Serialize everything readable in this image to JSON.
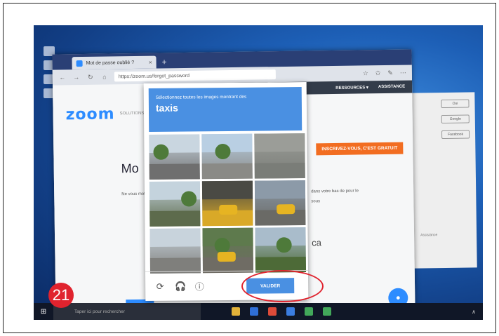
{
  "browser": {
    "tab_title": "Mot de passe oublié ?",
    "tab_close": "×",
    "new_tab": "+",
    "url": "https://zoom.us/forgot_password",
    "nav": [
      "←",
      "→",
      "↻",
      "⌂"
    ],
    "toolbar_icons": [
      "☆",
      "✩",
      "✎",
      "⋯"
    ]
  },
  "site": {
    "nav_items": [
      "RESSOURCES ▾",
      "ASSISTANCE"
    ],
    "logo": "zoom",
    "logo_sub": "SOLUTIONS",
    "signup_label": "INSCRIVEZ-VOUS, C'EST GRATUIT",
    "heading": "Mo",
    "text_left": "Ne vous mot de vous êt",
    "text_right": "dans votre bas de pour le sous",
    "captcha_fragment": "ca",
    "chat_icon": "●"
  },
  "right_window": {
    "buttons": [
      "Oui",
      "Google",
      "Facebook"
    ],
    "footer_text": "Assistance"
  },
  "captcha": {
    "instruction": "Sélectionnez toutes les images montrant des",
    "target": "taxis",
    "footer_icons": [
      "⟳",
      "🎧",
      "ⓘ"
    ],
    "validate_label": "VALIDER",
    "tiles": [
      {
        "sky": "#c9d6e0",
        "ground": "#6f6f6f",
        "tree": true,
        "car": false
      },
      {
        "sky": "#b9cfe3",
        "ground": "#8a8a86",
        "tree": true,
        "car": false
      },
      {
        "sky": "#9b9d98",
        "ground": "#7a7d78",
        "tree": false,
        "car": false
      },
      {
        "sky": "#c4d3dd",
        "ground": "#5d6b4c",
        "tree": true,
        "car": false
      },
      {
        "sky": "#4a4a44",
        "ground": "#d9a928",
        "tree": false,
        "car": true
      },
      {
        "sky": "#8c9aa8",
        "ground": "#6a6a66",
        "tree": false,
        "car": true
      },
      {
        "sky": "#c8d3dc",
        "ground": "#7f7f7c",
        "tree": false,
        "car": false
      },
      {
        "sky": "#5e7a4d",
        "ground": "#6f6c64",
        "tree": true,
        "car": true
      },
      {
        "sky": "#a9bccb",
        "ground": "#4d6a37",
        "tree": true,
        "car": false
      }
    ]
  },
  "taskbar": {
    "start_icon": "⊞",
    "search_placeholder": "Taper ici pour rechercher",
    "app_colors": [
      "#e2b23a",
      "#2f6fd8",
      "#dd4b39",
      "#3b7de0",
      "#42a85a",
      "#42a85a"
    ],
    "tray": "∧"
  },
  "step_badge": "21"
}
